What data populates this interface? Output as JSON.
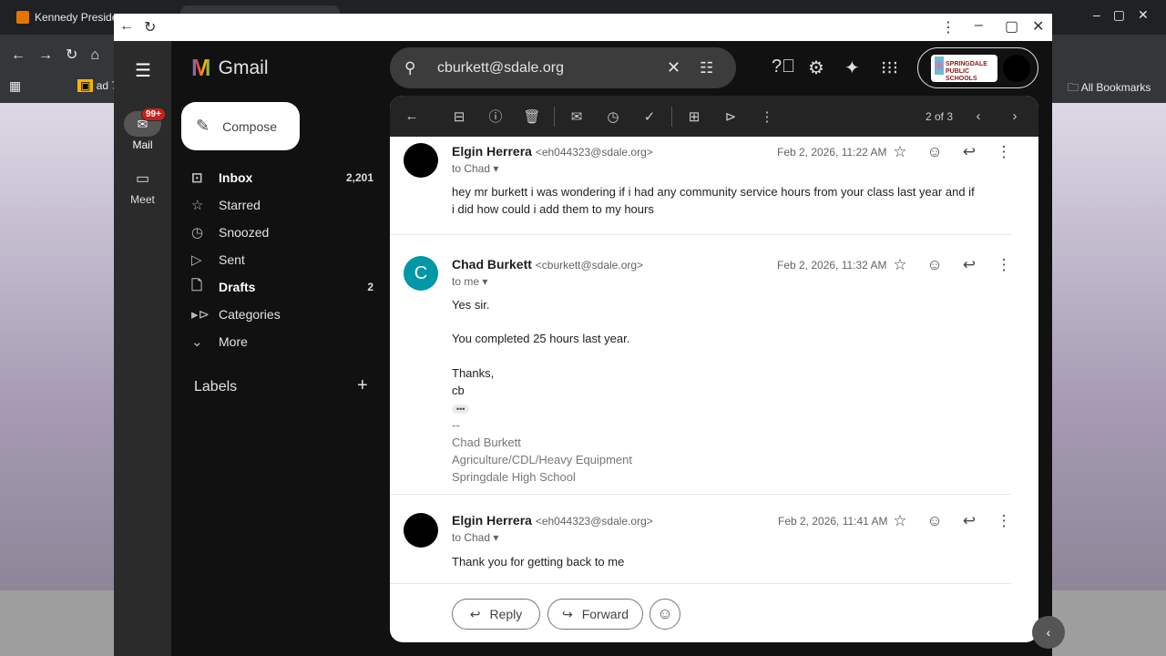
{
  "browser": {
    "tab_title": "Kennedy Preside",
    "bookmark": "ad 7",
    "all_bookmarks": "All Bookmarks"
  },
  "app": {
    "name": "Gmail",
    "search_value": "cburkett@sdale.org",
    "org_logo_text": "SPRINGDALE PUBLIC SCHOOLS"
  },
  "rail": {
    "mail": "Mail",
    "mail_badge": "99+",
    "meet": "Meet"
  },
  "nav": {
    "compose": "Compose",
    "items": [
      {
        "label": "Inbox",
        "count": "2,201",
        "icon": "inbox-icon"
      },
      {
        "label": "Starred",
        "count": "",
        "icon": "star-icon"
      },
      {
        "label": "Snoozed",
        "count": "",
        "icon": "clock-icon"
      },
      {
        "label": "Sent",
        "count": "",
        "icon": "send-icon"
      },
      {
        "label": "Drafts",
        "count": "2",
        "icon": "draft-icon"
      },
      {
        "label": "Categories",
        "count": "",
        "icon": "label-icon"
      },
      {
        "label": "More",
        "count": "",
        "icon": "chevron-down-icon"
      }
    ],
    "labels_heading": "Labels"
  },
  "toolbar": {
    "pagination": "2 of 3"
  },
  "messages": [
    {
      "sender": "Elgin Herrera",
      "email": "<eh044323@sdale.org>",
      "to": "to Chad",
      "date": "Feb 2, 2026, 11:22 AM",
      "body": "hey mr burkett i was wondering if i had any community service hours from your class last year and if i did how could i add them to my hours"
    },
    {
      "sender": "Chad Burkett",
      "email": "<cburkett@sdale.org>",
      "to": "to me",
      "date": "Feb 2, 2026, 11:32 AM",
      "avatar_letter": "C",
      "avatar_color": "#0097a7",
      "lines": [
        "Yes sir.",
        "You completed 25 hours last year.",
        "Thanks,",
        "cb"
      ],
      "signature": [
        "--",
        "Chad Burkett",
        "Agriculture/CDL/Heavy Equipment",
        "Springdale High School"
      ]
    },
    {
      "sender": "Elgin Herrera",
      "email": "<eh044323@sdale.org>",
      "to": "to Chad",
      "date": "Feb 2, 2026, 11:41 AM",
      "body": "Thank you for getting back to me"
    }
  ],
  "actions": {
    "reply": "Reply",
    "forward": "Forward"
  }
}
